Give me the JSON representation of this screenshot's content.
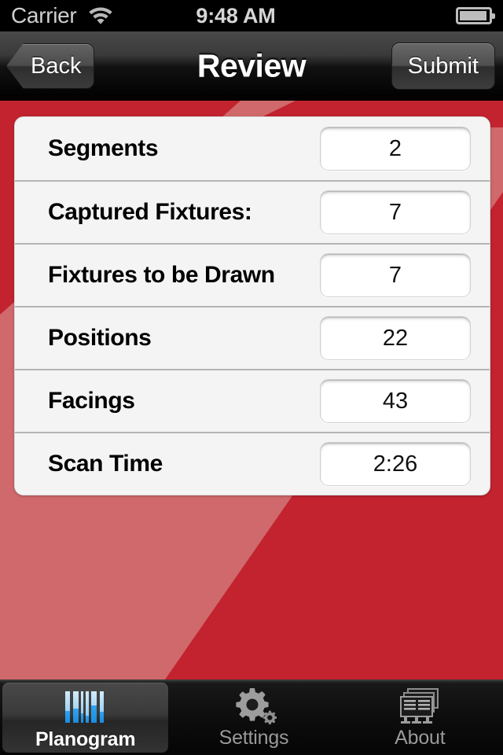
{
  "status_bar": {
    "carrier": "Carrier",
    "wifi_icon": "wifi-icon",
    "time": "9:48 AM",
    "battery_icon": "battery-icon"
  },
  "nav_bar": {
    "back_label": "Back",
    "title": "Review",
    "submit_label": "Submit"
  },
  "review": {
    "rows": [
      {
        "label": "Segments",
        "value": "2"
      },
      {
        "label": "Captured Fixtures:",
        "value": "7"
      },
      {
        "label": "Fixtures to be Drawn",
        "value": "7"
      },
      {
        "label": "Positions",
        "value": "22"
      },
      {
        "label": "Facings",
        "value": "43"
      },
      {
        "label": "Scan Time",
        "value": "2:26"
      }
    ]
  },
  "tab_bar": {
    "items": [
      {
        "label": "Planogram",
        "icon": "barcode-icon",
        "selected": true
      },
      {
        "label": "Settings",
        "icon": "gears-icon",
        "selected": false
      },
      {
        "label": "About",
        "icon": "shelf-stack-icon",
        "selected": false
      }
    ]
  },
  "colors": {
    "background_light_red": "#d0696b",
    "background_dark_red": "#c2232f",
    "card_background": "#f4f4f4",
    "tab_accent_blue": "#4aa8ee",
    "nav_bar_dark": "#111111"
  }
}
